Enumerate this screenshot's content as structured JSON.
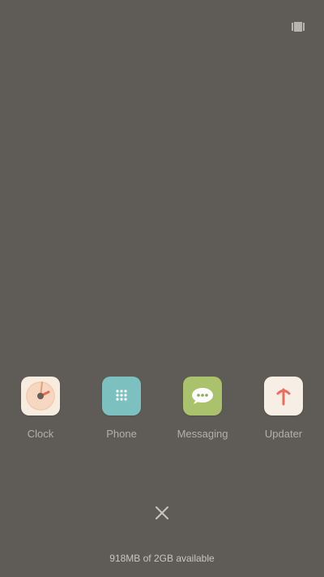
{
  "top_icon": "recents-view-icon",
  "apps": [
    {
      "label": "Clock",
      "icon": "clock-icon",
      "bg": "#f6ece0"
    },
    {
      "label": "Phone",
      "icon": "dialpad-icon",
      "bg": "#7cc0c0"
    },
    {
      "label": "Messaging",
      "icon": "chat-bubble-icon",
      "bg": "#a9c26b"
    },
    {
      "label": "Updater",
      "icon": "update-arrow-icon",
      "bg": "#f7eee6"
    }
  ],
  "close_icon": "close-icon",
  "memory": {
    "text": "918MB of 2GB available"
  },
  "colors": {
    "background": "#5f5c57",
    "label": "#b3b0ab"
  }
}
